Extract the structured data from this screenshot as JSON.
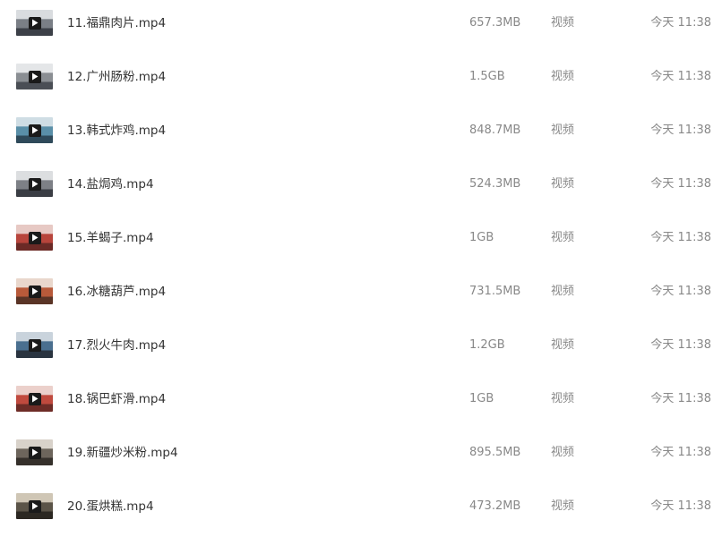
{
  "files": [
    {
      "name": "11.福鼎肉片.mp4",
      "size": "657.3MB",
      "type": "视频",
      "modified": "今天 11:38",
      "thumb_icon": "video-thumbnail-icon",
      "thumb_colors": [
        "#7a7f86",
        "#d9dcdf",
        "#3c4048"
      ]
    },
    {
      "name": "12.广州肠粉.mp4",
      "size": "1.5GB",
      "type": "视频",
      "modified": "今天 11:38",
      "thumb_icon": "video-thumbnail-icon",
      "thumb_colors": [
        "#8a8e93",
        "#e4e6e8",
        "#4a4e55"
      ]
    },
    {
      "name": "13.韩式炸鸡.mp4",
      "size": "848.7MB",
      "type": "视频",
      "modified": "今天 11:38",
      "thumb_icon": "video-thumbnail-icon",
      "thumb_colors": [
        "#5a8fa8",
        "#cfdde4",
        "#2f4a5a"
      ]
    },
    {
      "name": "14.盐焗鸡.mp4",
      "size": "524.3MB",
      "type": "视频",
      "modified": "今天 11:38",
      "thumb_icon": "video-thumbnail-icon",
      "thumb_colors": [
        "#7d8086",
        "#dcdee0",
        "#3a3d44"
      ]
    },
    {
      "name": "15.羊蝎子.mp4",
      "size": "1GB",
      "type": "视频",
      "modified": "今天 11:38",
      "thumb_icon": "video-thumbnail-icon",
      "thumb_colors": [
        "#b8453c",
        "#e7c9c4",
        "#6b2a26"
      ]
    },
    {
      "name": "16.冰糖葫芦.mp4",
      "size": "731.5MB",
      "type": "视频",
      "modified": "今天 11:38",
      "thumb_icon": "video-thumbnail-icon",
      "thumb_colors": [
        "#b85a3a",
        "#e9d7cc",
        "#5a3426"
      ]
    },
    {
      "name": "17.烈火牛肉.mp4",
      "size": "1.2GB",
      "type": "视频",
      "modified": "今天 11:38",
      "thumb_icon": "video-thumbnail-icon",
      "thumb_colors": [
        "#4a6f8f",
        "#c9d3dc",
        "#2a3440"
      ]
    },
    {
      "name": "18.锅巴虾滑.mp4",
      "size": "1GB",
      "type": "视频",
      "modified": "今天 11:38",
      "thumb_icon": "video-thumbnail-icon",
      "thumb_colors": [
        "#c04a3e",
        "#ebd0cb",
        "#6e2c27"
      ]
    },
    {
      "name": "19.新疆炒米粉.mp4",
      "size": "895.5MB",
      "type": "视频",
      "modified": "今天 11:38",
      "thumb_icon": "video-thumbnail-icon",
      "thumb_colors": [
        "#6d655c",
        "#d8d2ca",
        "#35302b"
      ]
    },
    {
      "name": "20.蛋烘糕.mp4",
      "size": "473.2MB",
      "type": "视频",
      "modified": "今天 11:38",
      "thumb_icon": "video-thumbnail-icon",
      "thumb_colors": [
        "#5b5448",
        "#cfc6b5",
        "#2c2822"
      ]
    }
  ]
}
